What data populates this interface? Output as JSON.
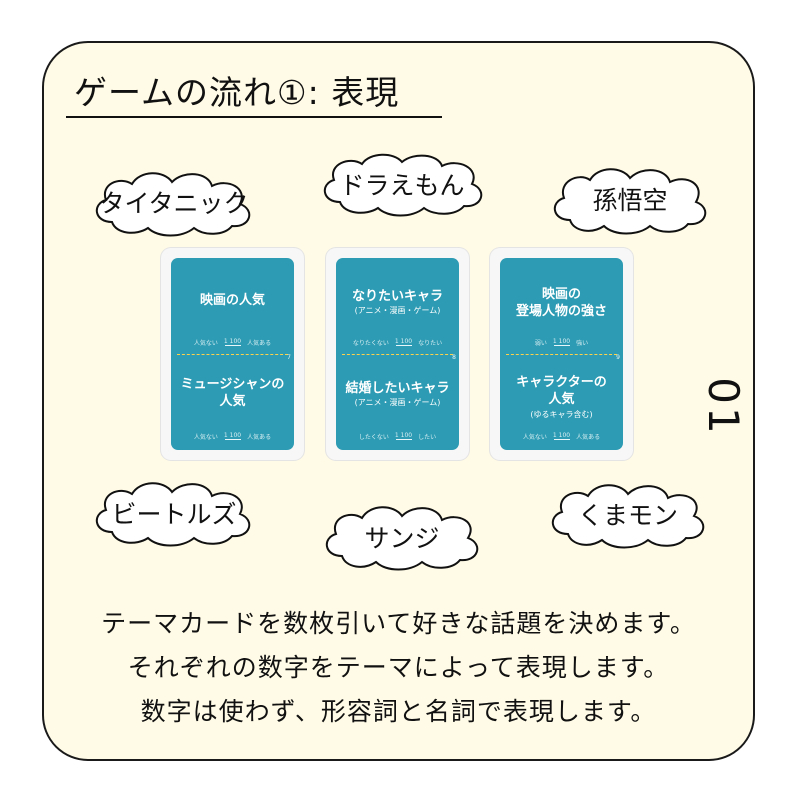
{
  "title": "ゲームの流れ①: 表現",
  "clouds": [
    {
      "text": "タイタニック"
    },
    {
      "text": "ドラえもん"
    },
    {
      "text": "孫悟空"
    },
    {
      "text": "ビートルズ"
    },
    {
      "text": "サンジ"
    },
    {
      "text": "くまモン"
    }
  ],
  "cards": [
    {
      "top": {
        "title": "映画の人気",
        "sub": "",
        "low": "人気ない",
        "high": "人気ある",
        "range": "1 100"
      },
      "bottom": {
        "title": "ミュージシャンの\n人気",
        "sub": "",
        "low": "人気ない",
        "high": "人気ある",
        "range": "1 100"
      },
      "number": "7"
    },
    {
      "top": {
        "title": "なりたいキャラ",
        "sub": "(アニメ・漫画・ゲーム)",
        "low": "なりたくない",
        "high": "なりたい",
        "range": "1 100"
      },
      "bottom": {
        "title": "結婚したいキャラ",
        "sub": "(アニメ・漫画・ゲーム)",
        "low": "したくない",
        "high": "したい",
        "range": "1 100"
      },
      "number": "8"
    },
    {
      "top": {
        "title": "映画の\n登場人物の強さ",
        "sub": "",
        "low": "弱い",
        "high": "強い",
        "range": "1 100"
      },
      "bottom": {
        "title": "キャラクターの\n人気",
        "sub": "(ゆるキャラ含む)",
        "low": "人気ない",
        "high": "人気ある",
        "range": "1 100"
      },
      "number": "9"
    }
  ],
  "page_number": "01",
  "description": [
    "テーマカードを数枚引いて好きな話題を決めます。",
    "それぞれの数字をテーマによって表現します。",
    "数字は使わず、形容詞と名詞で表現します。"
  ]
}
